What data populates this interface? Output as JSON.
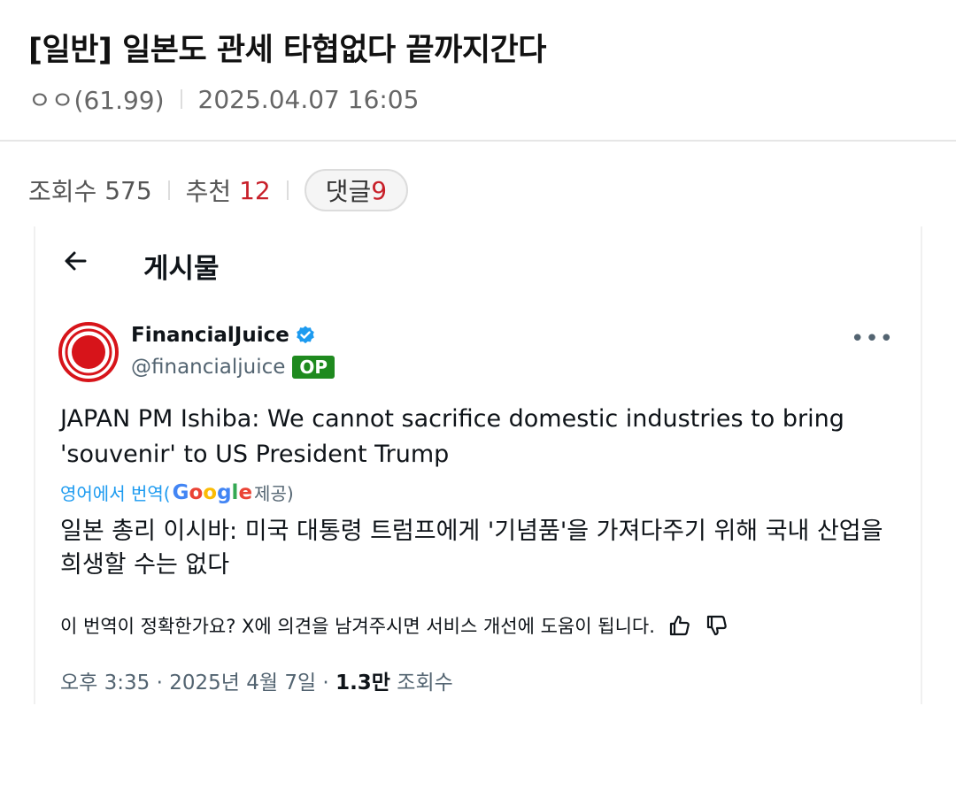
{
  "post": {
    "title": "[일반] 일본도 관세 타협없다 끝까지간다",
    "author": "ㅇㅇ(61.99)",
    "datetime": "2025.04.07 16:05"
  },
  "stats": {
    "views_label": "조회수",
    "views": "575",
    "recommend_label": "추천",
    "recommend": "12",
    "comments_label": "댓글",
    "comments": "9"
  },
  "embed": {
    "header": "게시물",
    "display_name": "FinancialJuice",
    "handle": "@financialjuice",
    "op_badge": "OP",
    "text": "JAPAN PM Ishiba: We cannot sacrifice domestic industries to bring 'souvenir' to US President Trump",
    "translated_from": "영어에서 번역(",
    "google": "Google",
    "provided": " 제공)",
    "translation": "일본 총리 이시바: 미국 대통령 트럼프에게 '기념품'을 가져다주기 위해 국내 산업을 희생할 수는 없다",
    "feedback": "이 번역이 정확한가요? X에 의견을 남겨주시면 서비스 개선에 도움이 됩니다.",
    "time": "오후 3:35 · 2025년 4월 7일 · ",
    "views_count": "1.3만",
    "views_label": " 조회수"
  },
  "colors": {
    "accent_red": "#c8202a",
    "verified_blue": "#1d9bf0",
    "op_green": "#1f8a1f"
  }
}
